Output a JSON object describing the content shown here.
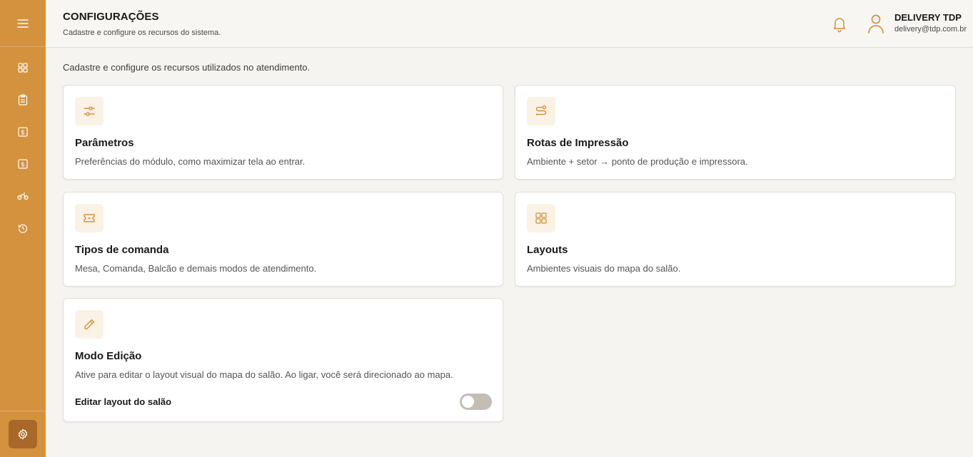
{
  "colors": {
    "accent": "#d4913e",
    "accent_dark": "#a9682a",
    "icon_bg": "#fbf2e6"
  },
  "sidebar": {
    "menu_icon": "hamburger-menu-icon",
    "items": [
      {
        "name": "sidebar-item-dashboard",
        "icon": "grid-icon"
      },
      {
        "name": "sidebar-item-orders",
        "icon": "clipboard-icon"
      },
      {
        "name": "sidebar-item-cashier",
        "icon": "money-icon"
      },
      {
        "name": "sidebar-item-finance",
        "icon": "money-icon"
      },
      {
        "name": "sidebar-item-delivery",
        "icon": "motorcycle-icon"
      },
      {
        "name": "sidebar-item-history",
        "icon": "history-icon"
      }
    ],
    "active_item": "settings-icon"
  },
  "header": {
    "title": "CONFIGURAÇÕES",
    "subtitle": "Cadastre e configure os recursos do sistema.",
    "user": {
      "name": "DELIVERY TDP",
      "email": "delivery@tdp.com.br"
    }
  },
  "main": {
    "intro": "Cadastre e configure os recursos utilizados no atendimento.",
    "cards": [
      {
        "title": "Parâmetros",
        "description": "Preferências do módulo, como maximizar tela ao entrar.",
        "icon": "sliders-icon"
      },
      {
        "title": "Rotas de Impressão",
        "description": "Ambiente + setor → ponto de produção e impressora.",
        "icon": "route-icon"
      },
      {
        "title": "Tipos de comanda",
        "description": "Mesa, Comanda, Balcão e demais modos de atendimento.",
        "icon": "ticket-icon"
      },
      {
        "title": "Layouts",
        "description": "Ambientes visuais do mapa do salão.",
        "icon": "grid-icon"
      },
      {
        "title": "Modo Edição",
        "description": "Ative para editar o layout visual do mapa do salão. Ao ligar, você será direcionado ao mapa.",
        "icon": "pencil-icon",
        "toggle_label": "Editar layout do salão",
        "toggle_on": false
      }
    ]
  }
}
